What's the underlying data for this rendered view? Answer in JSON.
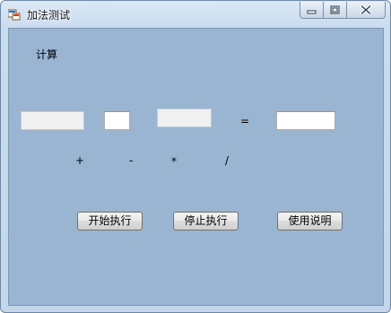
{
  "window": {
    "title": "加法测试",
    "minimize_icon": "minimize-icon",
    "maximize_icon": "maximize-icon",
    "close_icon": "close-icon",
    "app_icon": "app-windows-icon"
  },
  "form": {
    "label_calc": "计算",
    "operand1": {
      "value": "",
      "placeholder": ""
    },
    "operator_input": {
      "value": "",
      "placeholder": ""
    },
    "operand2": {
      "value": "",
      "placeholder": ""
    },
    "equals": "=",
    "result": {
      "value": "",
      "placeholder": ""
    },
    "operators": [
      "+",
      "-",
      "*",
      "/"
    ],
    "buttons": {
      "start": "开始执行",
      "stop": "停止执行",
      "help": "使用说明"
    }
  },
  "colors": {
    "client_background": "#9ab5d1",
    "window_frame": "#c9dcef"
  }
}
